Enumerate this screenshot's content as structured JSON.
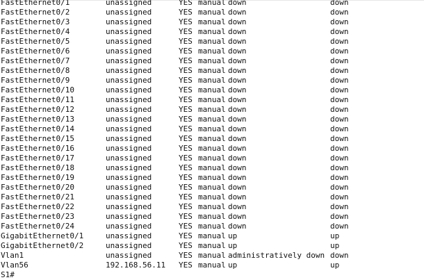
{
  "terminal": {
    "rows": [
      {
        "iface": "FastEthernet0/1",
        "ip": "unassigned",
        "ok": "YES",
        "method": "manual",
        "status": "down",
        "protocol": "down"
      },
      {
        "iface": "FastEthernet0/2",
        "ip": "unassigned",
        "ok": "YES",
        "method": "manual",
        "status": "down",
        "protocol": "down"
      },
      {
        "iface": "FastEthernet0/3",
        "ip": "unassigned",
        "ok": "YES",
        "method": "manual",
        "status": "down",
        "protocol": "down"
      },
      {
        "iface": "FastEthernet0/4",
        "ip": "unassigned",
        "ok": "YES",
        "method": "manual",
        "status": "down",
        "protocol": "down"
      },
      {
        "iface": "FastEthernet0/5",
        "ip": "unassigned",
        "ok": "YES",
        "method": "manual",
        "status": "down",
        "protocol": "down"
      },
      {
        "iface": "FastEthernet0/6",
        "ip": "unassigned",
        "ok": "YES",
        "method": "manual",
        "status": "down",
        "protocol": "down"
      },
      {
        "iface": "FastEthernet0/7",
        "ip": "unassigned",
        "ok": "YES",
        "method": "manual",
        "status": "down",
        "protocol": "down"
      },
      {
        "iface": "FastEthernet0/8",
        "ip": "unassigned",
        "ok": "YES",
        "method": "manual",
        "status": "down",
        "protocol": "down"
      },
      {
        "iface": "FastEthernet0/9",
        "ip": "unassigned",
        "ok": "YES",
        "method": "manual",
        "status": "down",
        "protocol": "down"
      },
      {
        "iface": "FastEthernet0/10",
        "ip": "unassigned",
        "ok": "YES",
        "method": "manual",
        "status": "down",
        "protocol": "down"
      },
      {
        "iface": "FastEthernet0/11",
        "ip": "unassigned",
        "ok": "YES",
        "method": "manual",
        "status": "down",
        "protocol": "down"
      },
      {
        "iface": "FastEthernet0/12",
        "ip": "unassigned",
        "ok": "YES",
        "method": "manual",
        "status": "down",
        "protocol": "down"
      },
      {
        "iface": "FastEthernet0/13",
        "ip": "unassigned",
        "ok": "YES",
        "method": "manual",
        "status": "down",
        "protocol": "down"
      },
      {
        "iface": "FastEthernet0/14",
        "ip": "unassigned",
        "ok": "YES",
        "method": "manual",
        "status": "down",
        "protocol": "down"
      },
      {
        "iface": "FastEthernet0/15",
        "ip": "unassigned",
        "ok": "YES",
        "method": "manual",
        "status": "down",
        "protocol": "down"
      },
      {
        "iface": "FastEthernet0/16",
        "ip": "unassigned",
        "ok": "YES",
        "method": "manual",
        "status": "down",
        "protocol": "down"
      },
      {
        "iface": "FastEthernet0/17",
        "ip": "unassigned",
        "ok": "YES",
        "method": "manual",
        "status": "down",
        "protocol": "down"
      },
      {
        "iface": "FastEthernet0/18",
        "ip": "unassigned",
        "ok": "YES",
        "method": "manual",
        "status": "down",
        "protocol": "down"
      },
      {
        "iface": "FastEthernet0/19",
        "ip": "unassigned",
        "ok": "YES",
        "method": "manual",
        "status": "down",
        "protocol": "down"
      },
      {
        "iface": "FastEthernet0/20",
        "ip": "unassigned",
        "ok": "YES",
        "method": "manual",
        "status": "down",
        "protocol": "down"
      },
      {
        "iface": "FastEthernet0/21",
        "ip": "unassigned",
        "ok": "YES",
        "method": "manual",
        "status": "down",
        "protocol": "down"
      },
      {
        "iface": "FastEthernet0/22",
        "ip": "unassigned",
        "ok": "YES",
        "method": "manual",
        "status": "down",
        "protocol": "down"
      },
      {
        "iface": "FastEthernet0/23",
        "ip": "unassigned",
        "ok": "YES",
        "method": "manual",
        "status": "down",
        "protocol": "down"
      },
      {
        "iface": "FastEthernet0/24",
        "ip": "unassigned",
        "ok": "YES",
        "method": "manual",
        "status": "down",
        "protocol": "down"
      },
      {
        "iface": "GigabitEthernet0/1",
        "ip": "unassigned",
        "ok": "YES",
        "method": "manual",
        "status": "up",
        "protocol": "up"
      },
      {
        "iface": "GigabitEthernet0/2",
        "ip": "unassigned",
        "ok": "YES",
        "method": "manual",
        "status": "up",
        "protocol": "up"
      },
      {
        "iface": "Vlan1",
        "ip": "unassigned",
        "ok": "YES",
        "method": "manual",
        "status": "administratively down",
        "protocol": "down"
      },
      {
        "iface": "Vlan56",
        "ip": "192.168.56.11",
        "ok": "YES",
        "method": "manual",
        "status": "up",
        "protocol": "up"
      }
    ],
    "prompt": "S1#"
  },
  "colors": {
    "background": "#ffffff",
    "text": "#111111"
  }
}
